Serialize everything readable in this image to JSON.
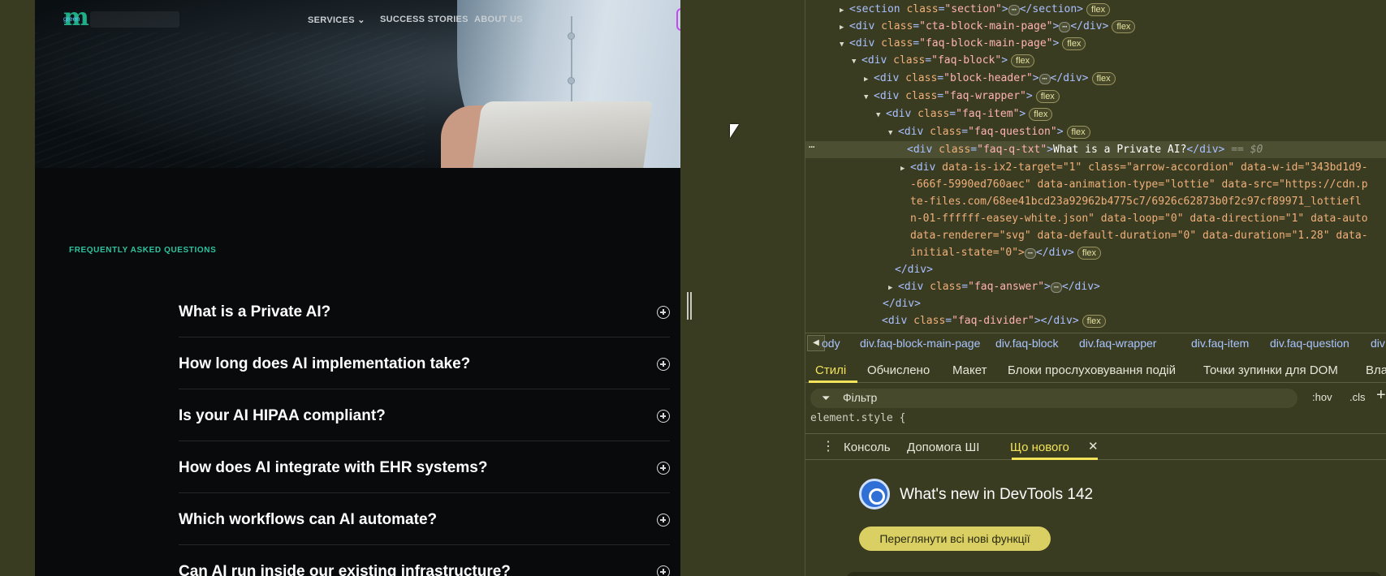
{
  "site": {
    "nav": {
      "logo_letter": "m",
      "logo_word": "green",
      "services": "SERVICES",
      "success_stories": "SUCCESS STORIES",
      "about_us": "ABOUT US"
    },
    "faq": {
      "eyebrow": "FREQUENTLY ASKED QUESTIONS",
      "questions": [
        "What is a Private AI?",
        "How long does AI implementation take?",
        "Is your AI HIPAA compliant?",
        "How does AI integrate with EHR systems?",
        "Which workflows can AI automate?",
        "Can AI run inside our existing infrastructure?"
      ]
    }
  },
  "devtools": {
    "dom": {
      "l1_class": "section",
      "l2_class": "cta-block-main-page",
      "l3_class": "faq-block-main-page",
      "l4_class": "faq-block",
      "l5_class": "block-header",
      "l6_class": "faq-wrapper",
      "l7_class": "faq-item",
      "l8_class": "faq-question",
      "l9_class": "faq-q-txt",
      "l9_text": "What is a Private AI?",
      "l9_eq": "== $0",
      "l10_a": "data-is-ix2-target=\"1\" class=\"arrow-accordion\" data-w-id=\"343bd1d9-",
      "l10_b": "-666f-5990ed760aec\" data-animation-type=\"lottie\" data-src=\"https://cdn.p",
      "l10_c": "te-files.com/68ee41bcd23a92962b4775c7/6926c62873b0f2c97cf89971_lottiefl",
      "l10_d": "n-01-ffffff-easey-white.json\" data-loop=\"0\" data-direction=\"1\" data-auto",
      "l10_e": "data-renderer=\"svg\" data-default-duration=\"0\" data-duration=\"1.28\" data-",
      "l10_f": "initial-state=\"0\">",
      "l11_class": "faq-answer",
      "l12_class": "faq-divider",
      "flex": "flex"
    },
    "breadcrumbs": [
      "ody",
      "div.faq-block-main-page",
      "div.faq-block",
      "div.faq-wrapper",
      "div.faq-item",
      "div.faq-question",
      "div"
    ],
    "tabs": [
      "Стилі",
      "Обчислено",
      "Макет",
      "Блоки прослуховування подій",
      "Точки зупинки для DOM",
      "Вла"
    ],
    "filter_placeholder": "Фільтр",
    "hov": ":hov",
    "cls": ".cls",
    "element_style": "element.style {",
    "drawer": {
      "tabs": [
        "Консоль",
        "Допомога ШІ",
        "Що нового"
      ],
      "close": "✕",
      "title": "What's new in DevTools 142",
      "button": "Переглянути всі нові функції"
    }
  }
}
